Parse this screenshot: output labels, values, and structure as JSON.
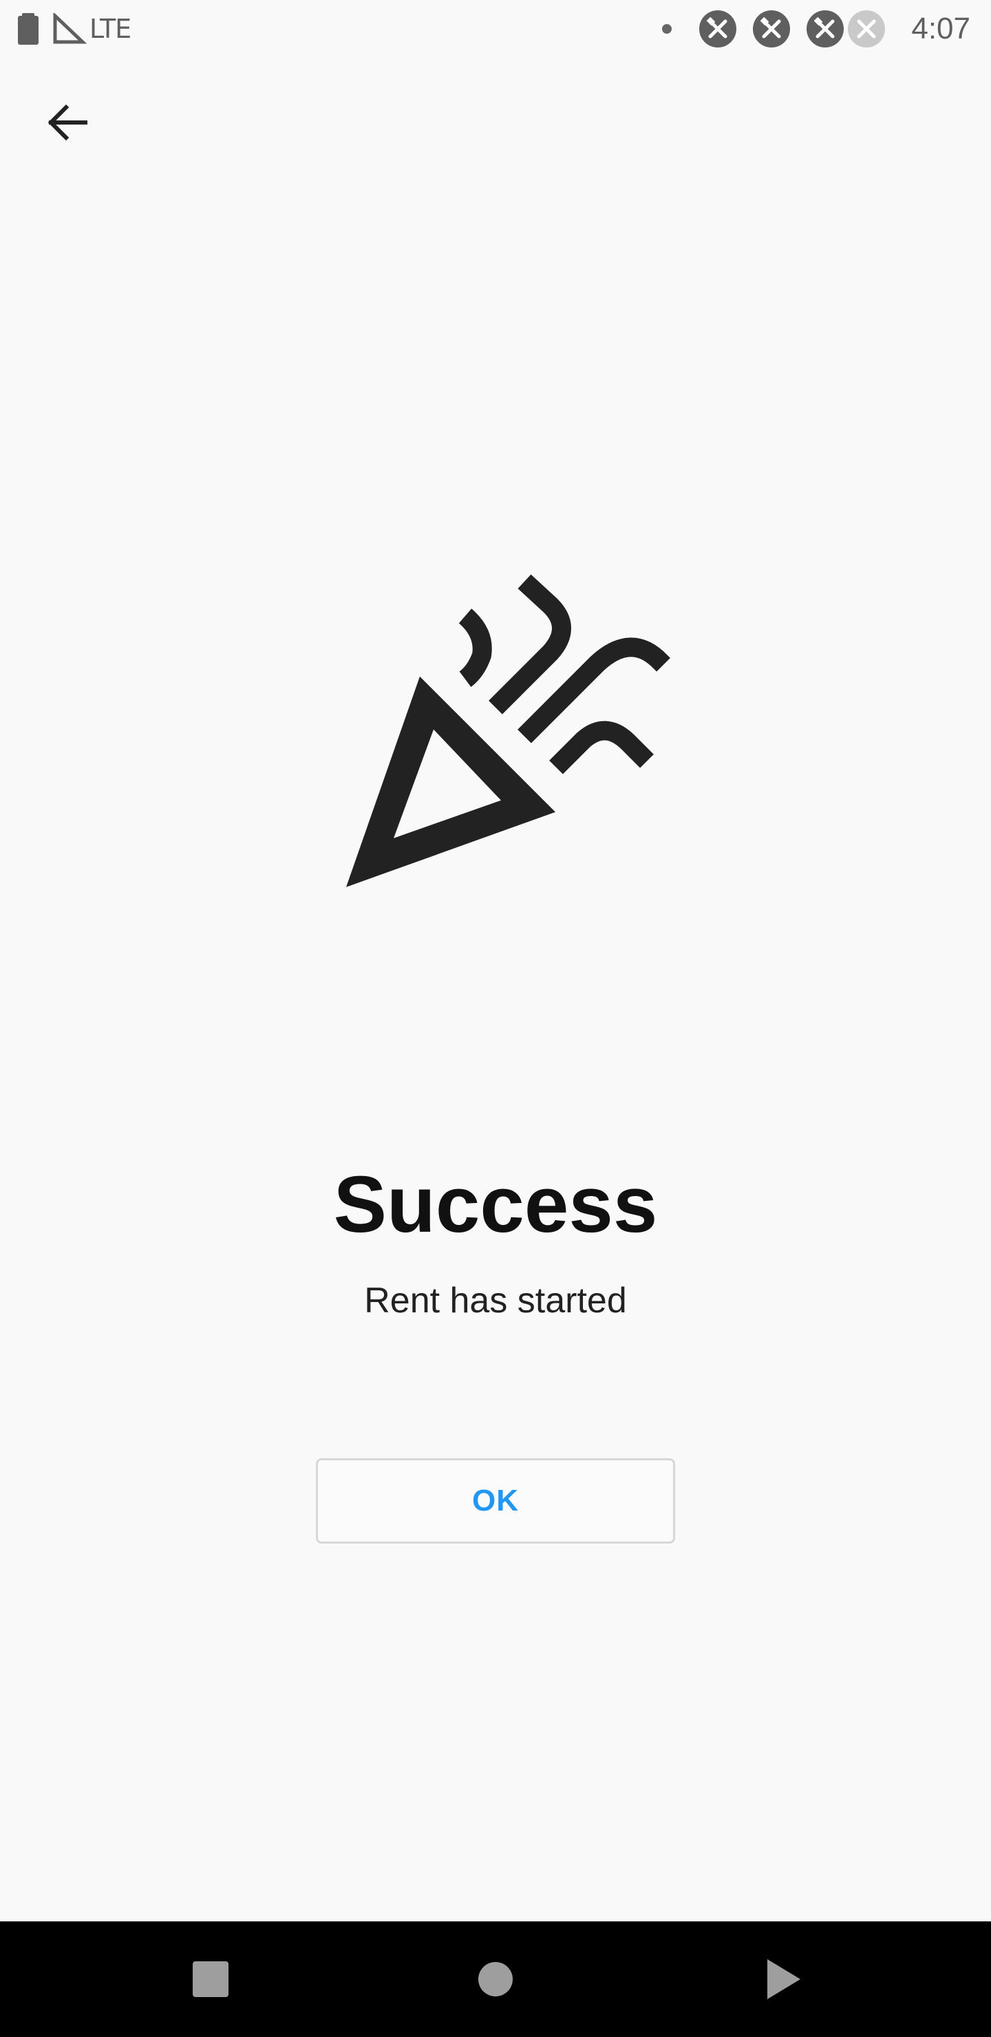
{
  "status_bar": {
    "network": "LTE",
    "time": "4:07",
    "icon_color": "#5f5f5f",
    "icons": [
      "battery-icon",
      "signal-icon",
      "notification-dot",
      "tools-notification-icon",
      "tools-notification-icon",
      "tools-notification-icon",
      "tools-notification-icon-faded"
    ]
  },
  "header": {
    "back_icon": "arrow-left-icon"
  },
  "main": {
    "illustration_icon": "party-popper-icon",
    "title": "Success",
    "subtitle": "Rent has started",
    "ok_label": "OK",
    "accent_color": "#2196f3"
  },
  "nav_bar": {
    "buttons": [
      "recent-apps-icon",
      "home-icon",
      "back-triangle-icon"
    ]
  }
}
